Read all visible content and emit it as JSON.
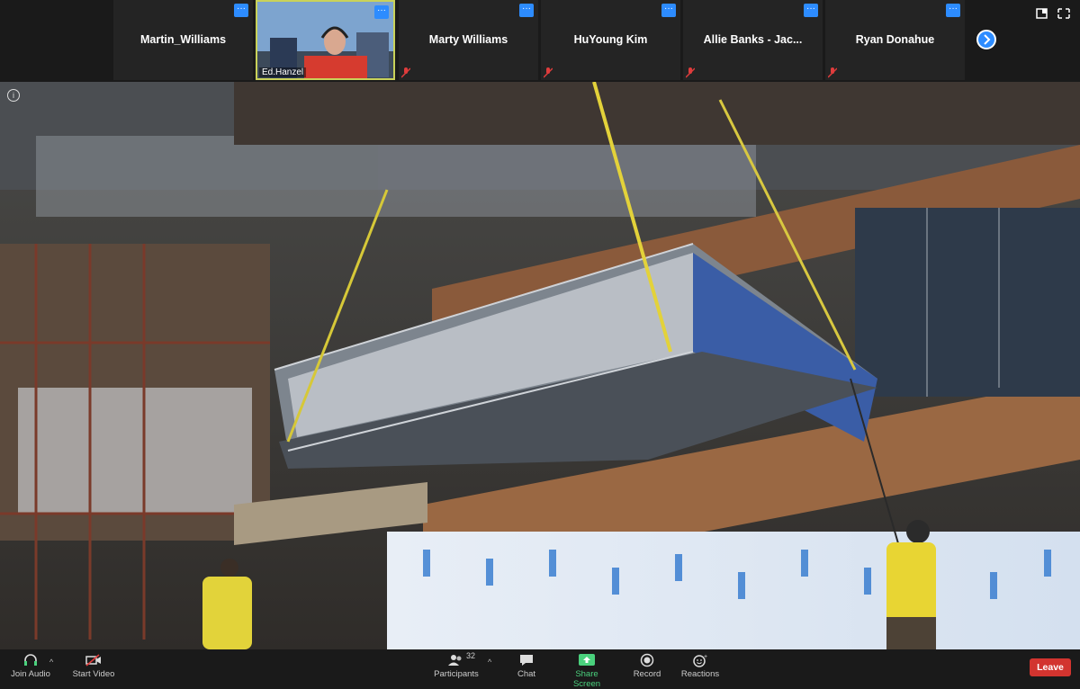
{
  "participants": [
    {
      "name": "Martin_Williams",
      "muted": false
    },
    {
      "name": "Ed.Hanzel",
      "video": true
    },
    {
      "name": "Marty Williams",
      "muted": true
    },
    {
      "name": "HuYoung Kim",
      "muted": true
    },
    {
      "name": "Allie Banks - Jac...",
      "muted": true
    },
    {
      "name": "Ryan Donahue",
      "muted": true
    }
  ],
  "tile_more_glyph": "···",
  "info_glyph": "i",
  "toolbar": {
    "join_audio": "Join Audio",
    "start_video": "Start Video",
    "participants": "Participants",
    "participant_count": "32",
    "chat": "Chat",
    "share_screen": "Share Screen",
    "record": "Record",
    "reactions": "Reactions",
    "leave": "Leave"
  },
  "colors": {
    "accent_blue": "#2d8cff",
    "share_green": "#4ad17d",
    "leave_red": "#d2342f",
    "speaker_border": "#c9d25a"
  }
}
